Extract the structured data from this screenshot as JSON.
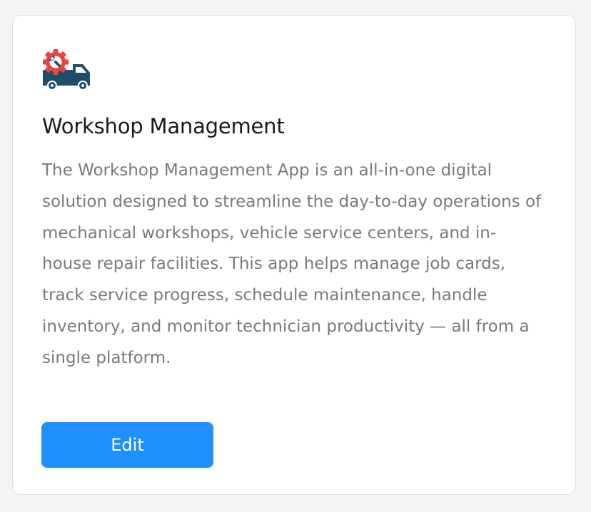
{
  "card": {
    "icon": "truck-gear-wrench-icon",
    "title": "Workshop Management",
    "description": "The Workshop Management App is an all-in-one digital solution designed to streamline the day-to-day operations of mechanical workshops, vehicle service centers, and in-house repair facilities. This app helps manage job cards, track service progress, schedule maintenance, handle inventory, and monitor technician productivity — all from a single platform.",
    "edit_label": "Edit"
  },
  "colors": {
    "accent": "#1e90ff",
    "gear": "#e8453c",
    "truck": "#1f4e6b",
    "title": "#1a1a1a",
    "description": "#7a7a7a"
  }
}
